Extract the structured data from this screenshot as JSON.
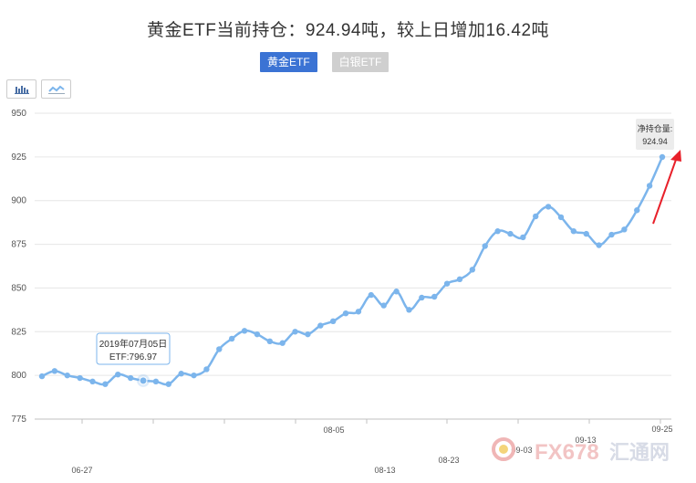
{
  "header": {
    "title": "黄金ETF当前持仓：924.94吨，较上日增加16.42吨"
  },
  "tabs": [
    {
      "label": "黄金ETF",
      "active": true
    },
    {
      "label": "白银ETF",
      "active": false
    }
  ],
  "toolbar": {
    "bar_icon": "bar-chart-icon",
    "line_icon": "line-chart-icon"
  },
  "tooltip": {
    "date": "2019年07月05日",
    "value": "ETF:796.97"
  },
  "last_label": {
    "label": "净持仓量:",
    "value": "924.94"
  },
  "watermark": {
    "text1": "FX678",
    "text2": "汇通网"
  },
  "colors": {
    "line": "#7cb5ec",
    "tab_active": "#3b73d4",
    "arrow": "#e8202a"
  },
  "chart_data": {
    "type": "line",
    "title": "",
    "xlabel": "",
    "ylabel": "",
    "ylim": [
      775,
      950
    ],
    "yticks": [
      775,
      800,
      825,
      850,
      875,
      900,
      925,
      950
    ],
    "x_tick_labels": [
      "06-27",
      "08-05",
      "08-13",
      "08-23",
      "09-03",
      "09-13",
      "09-25"
    ],
    "grid": true,
    "series": [
      {
        "values": [
          799.5,
          802.5,
          800.0,
          798.5,
          796.5,
          795.0,
          800.5,
          798.5,
          797.0,
          796.5,
          795.0,
          801.0,
          800.0,
          803.5,
          815.0,
          821.0,
          825.5,
          823.5,
          819.5,
          818.5,
          825.0,
          823.5,
          828.5,
          831.0,
          835.5,
          836.5,
          846.0,
          840.0,
          848.0,
          837.5,
          844.5,
          845.0,
          852.5,
          855.0,
          860.5,
          874.0,
          882.5,
          881.0,
          879.0,
          891.0,
          896.5,
          890.5,
          882.5,
          881.0,
          874.5,
          880.5,
          883.5,
          894.5,
          908.5,
          924.94
        ]
      }
    ]
  }
}
